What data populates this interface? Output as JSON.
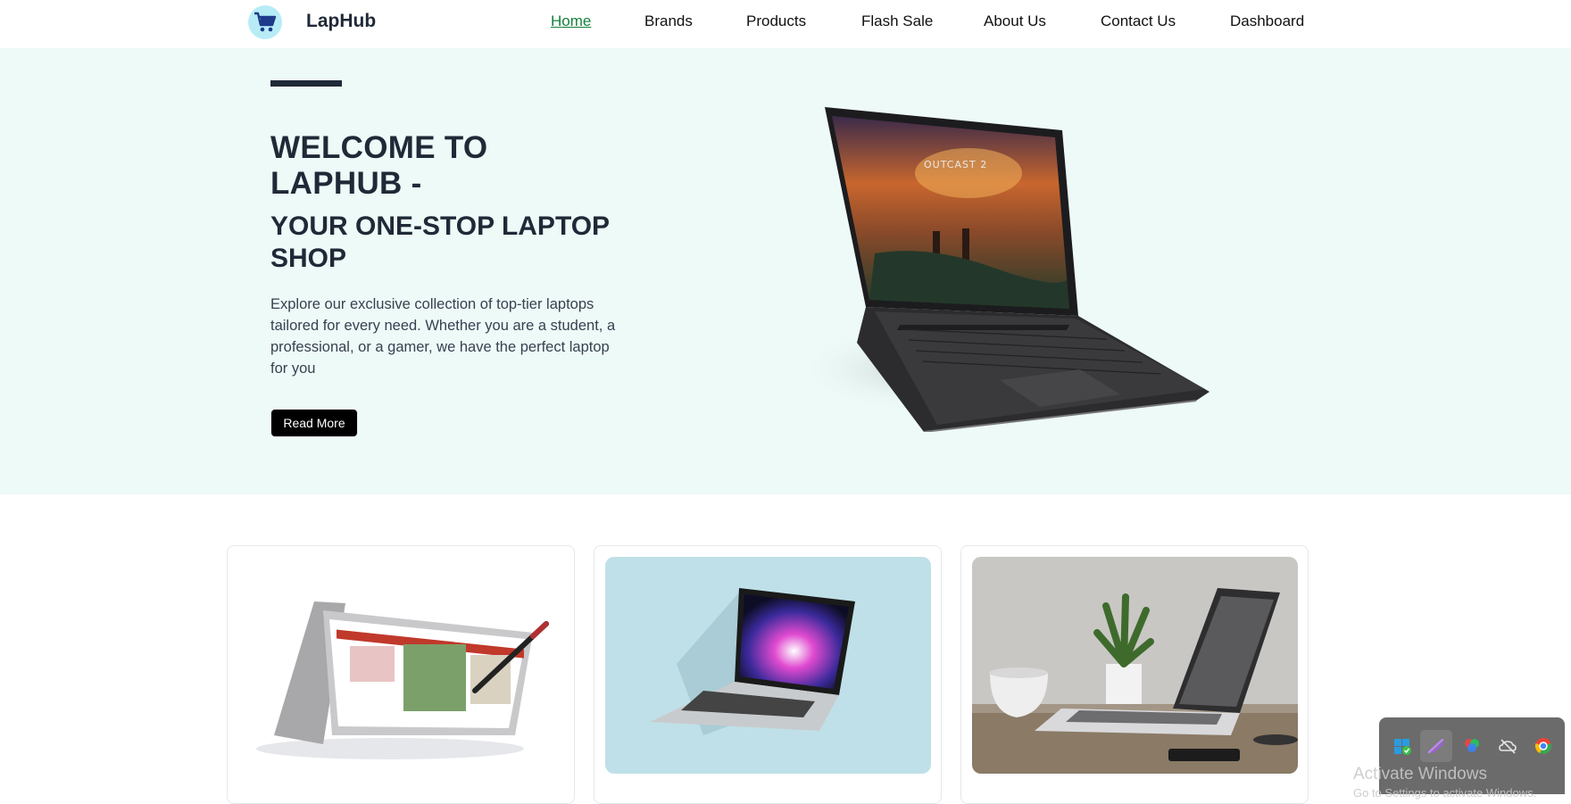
{
  "nav": {
    "brand": "LapHub",
    "logo_icon": "shopping-cart-icon",
    "links": [
      "Home",
      "Brands",
      "Products",
      "Flash Sale",
      "About Us",
      "Contact Us",
      "Dashboard"
    ],
    "active": "Home"
  },
  "hero": {
    "title_line1": "WELCOME TO",
    "title_line2": "LAPHUB -",
    "subtitle_line1": "YOUR ONE-STOP LAPTOP",
    "subtitle_line2": "SHOP",
    "description": "Explore our exclusive collection of top-tier laptops tailored for every need. Whether you are a student, a professional, or a gamer, we have the perfect laptop for you",
    "button": "Read More",
    "image_icon": "gaming-laptop-image"
  },
  "cards": [
    {
      "image_icon": "convertible-laptop-with-stylus-image"
    },
    {
      "image_icon": "silver-laptop-on-blue-image"
    },
    {
      "image_icon": "laptop-on-desk-with-plant-image"
    }
  ],
  "system": {
    "tray_icons": [
      "defender-icon",
      "pen-icon",
      "color-wheel-icon",
      "cloud-off-icon",
      "chrome-icon"
    ],
    "watermark": "Activate Windows",
    "watermark_sub": "Go to Settings to activate Windows."
  },
  "colors": {
    "active_link": "#15803d",
    "hero_bg": "#eefaf8",
    "heading": "#1f2937",
    "button_bg": "#000000"
  }
}
